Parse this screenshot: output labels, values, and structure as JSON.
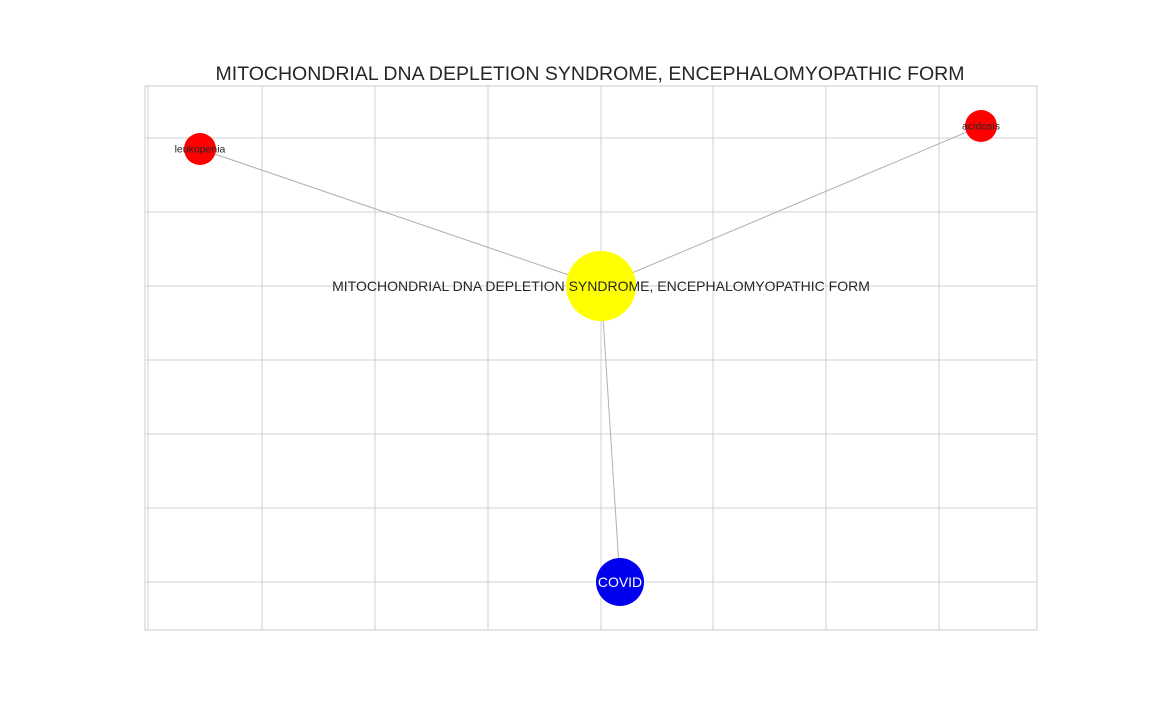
{
  "figure": {
    "title": "MITOCHONDRIAL DNA DEPLETION SYNDROME, ENCEPHALOMYOPATHIC FORM"
  },
  "graph": {
    "nodes": [
      {
        "id": "center",
        "label": "MITOCHONDRIAL DNA DEPLETION SYNDROME, ENCEPHALOMYOPATHIC FORM",
        "color": "#ffff00",
        "text_color": "#262626"
      },
      {
        "id": "leukopenia",
        "label": "leukopenia",
        "color": "#ff0000",
        "text_color": "#262626"
      },
      {
        "id": "acidosis",
        "label": "acidosis",
        "color": "#ff0000",
        "text_color": "#262626"
      },
      {
        "id": "covid",
        "label": "COVID",
        "color": "#0000ee",
        "text_color": "#ffffff"
      }
    ],
    "edges": [
      {
        "source": "center",
        "target": "leukopenia"
      },
      {
        "source": "center",
        "target": "acidosis"
      },
      {
        "source": "center",
        "target": "covid"
      }
    ],
    "edge_color": "#b0b0b0",
    "grid": true,
    "grid_color": "#d0d0d0",
    "frame_color": "#cccccc"
  }
}
